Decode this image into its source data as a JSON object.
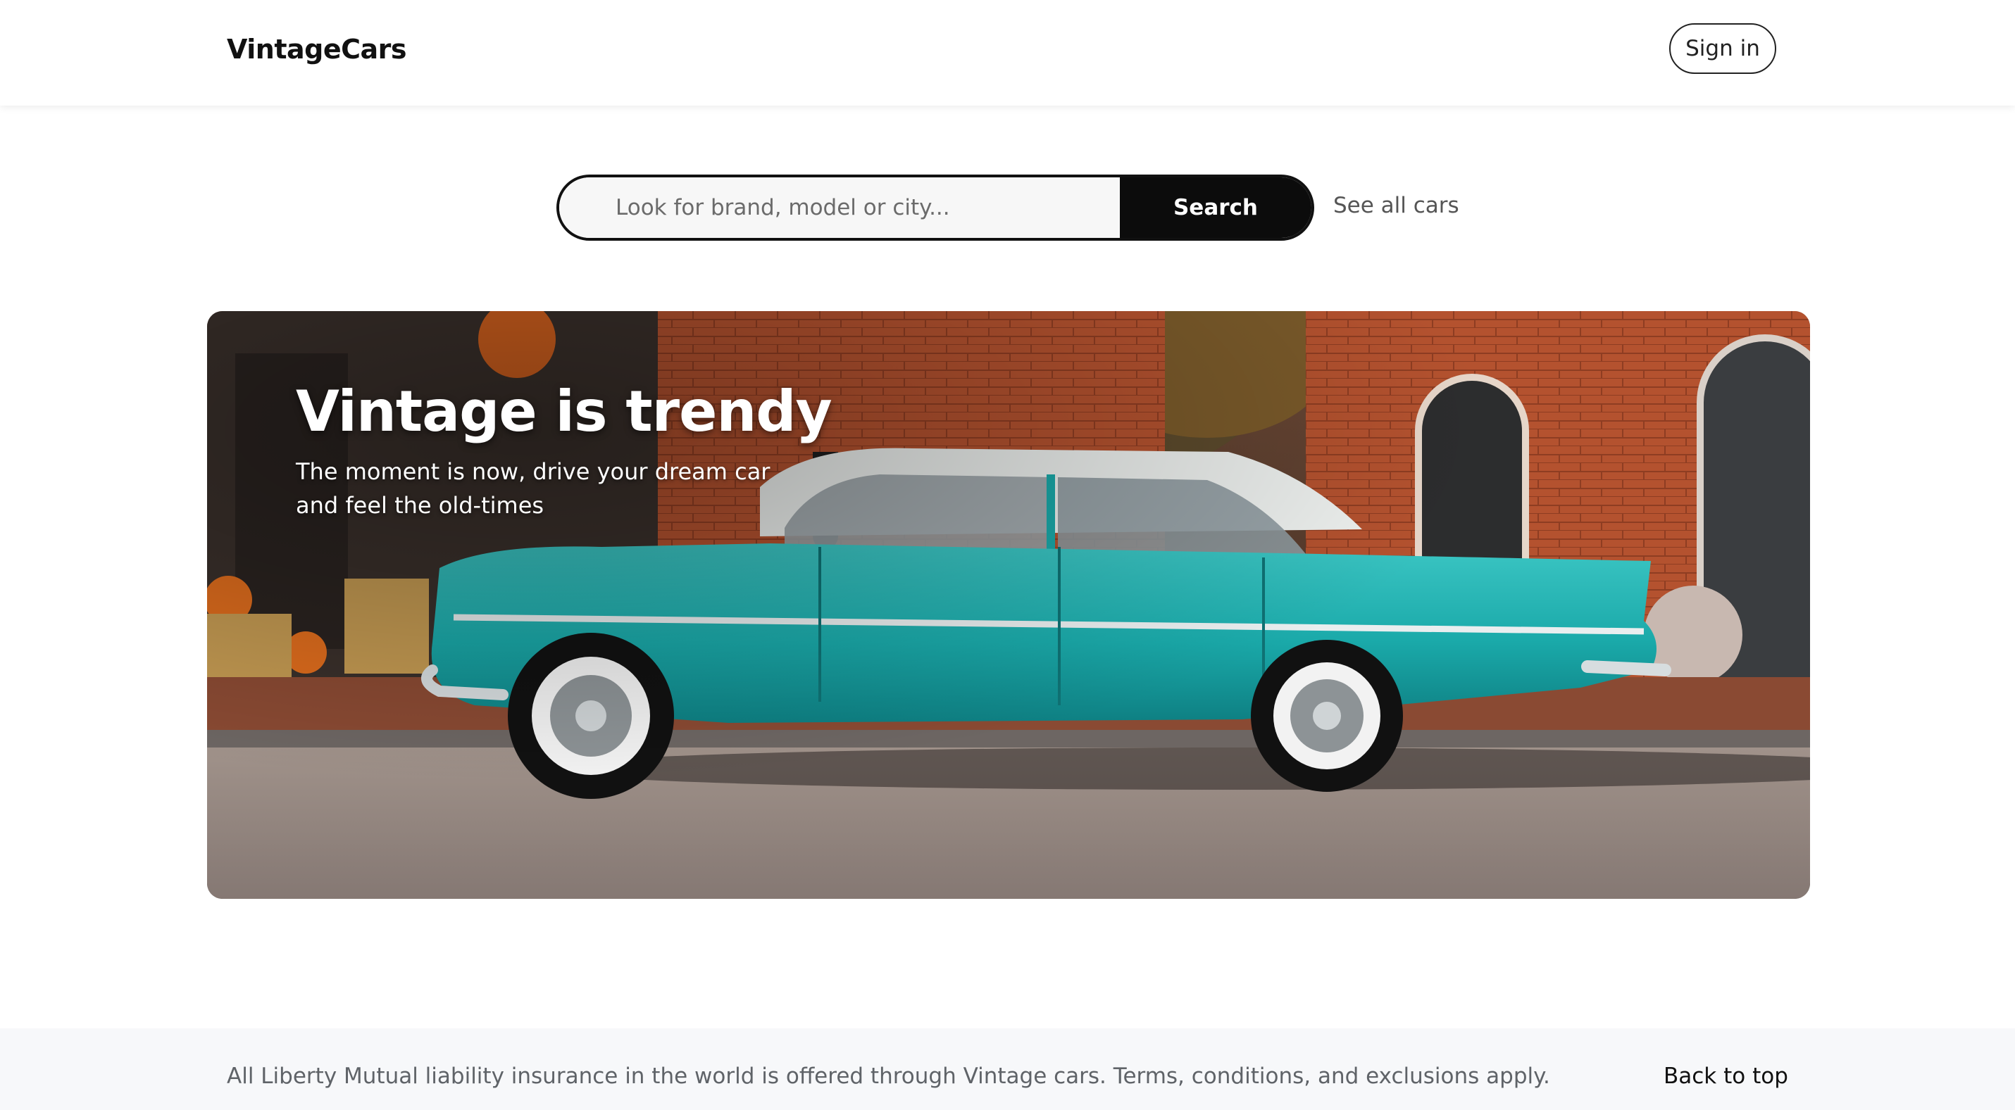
{
  "header": {
    "brand": "VintageCars",
    "signin_label": "Sign in"
  },
  "search": {
    "placeholder": "Look for brand, model or city...",
    "button_label": "Search",
    "see_all_label": "See all cars"
  },
  "hero": {
    "title": "Vintage is trendy",
    "subtitle": "The moment is now, drive your dream car and feel the old-times",
    "image_alt": "turquoise vintage car parked in front of brick storefronts",
    "colors": {
      "car_body": "#1fb3b3",
      "brick": "#b4522f",
      "road": "#8f8580"
    }
  },
  "footer": {
    "notice": "All Liberty Mutual liability insurance in the world is offered through Vintage cars. Terms, conditions, and exclusions apply.",
    "back_to_top": "Back to top"
  }
}
